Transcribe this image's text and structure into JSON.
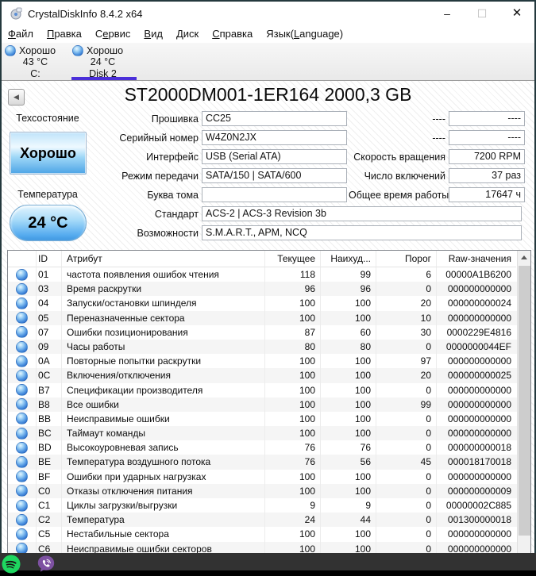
{
  "window": {
    "title": "CrystalDiskInfo 8.4.2 x64",
    "minimize_glyph": "–",
    "maximize_glyph": "☐",
    "close_glyph": "✕"
  },
  "menu": {
    "items": [
      {
        "id": "file",
        "pre": "",
        "key": "Ф",
        "post": "айл"
      },
      {
        "id": "edit",
        "pre": "",
        "key": "П",
        "post": "равка"
      },
      {
        "id": "function",
        "pre": "С",
        "key": "е",
        "post": "рвис"
      },
      {
        "id": "view",
        "pre": "",
        "key": "В",
        "post": "ид"
      },
      {
        "id": "disk",
        "pre": "",
        "key": "Д",
        "post": "иск"
      },
      {
        "id": "help",
        "pre": "",
        "key": "С",
        "post": "правка"
      },
      {
        "id": "language",
        "pre": "Язык(",
        "key": "L",
        "post": "anguage)"
      }
    ]
  },
  "drive_tabs": [
    {
      "status": "Хорошо",
      "temp": "43 °C",
      "name": "C:",
      "selected": false
    },
    {
      "status": "Хорошо",
      "temp": "24 °C",
      "name": "Disk 2",
      "selected": true
    }
  ],
  "header": {
    "back_glyph": "◀",
    "model": "ST2000DM001-1ER164 2000,3 GB"
  },
  "health": {
    "label": "Техсостояние",
    "value": "Хорошо"
  },
  "temperature": {
    "label": "Температура",
    "value": "24 °C"
  },
  "info_left": [
    {
      "label": "Прошивка",
      "value": "CC25"
    },
    {
      "label": "Серийный номер",
      "value": "W4Z0N2JX"
    },
    {
      "label": "Интерфейс",
      "value": "USB (Serial ATA)"
    },
    {
      "label": "Режим передачи",
      "value": "SATA/150 | SATA/600"
    },
    {
      "label": "Буква тома",
      "value": ""
    }
  ],
  "info_right": [
    {
      "label": "----",
      "value": "----"
    },
    {
      "label": "----",
      "value": "----"
    },
    {
      "label": "Скорость вращения",
      "value": "7200 RPM"
    },
    {
      "label": "Число включений",
      "value": "37 раз"
    },
    {
      "label": "Общее время работы",
      "value": "17647 ч"
    }
  ],
  "info_wide": [
    {
      "label": "Стандарт",
      "value": "ACS-2 | ACS-3 Revision 3b"
    },
    {
      "label": "Возможности",
      "value": "S.M.A.R.T., APM, NCQ"
    }
  ],
  "smart": {
    "columns": [
      "ID",
      "Атрибут",
      "Текущее",
      "Наихуд...",
      "Порог",
      "Raw-значения"
    ],
    "status_icon": "blue-health-sphere",
    "rows": [
      {
        "id": "01",
        "attr": "частота появления ошибок чтения",
        "cur": "118",
        "worst": "99",
        "thr": "6",
        "raw": "00000A1B6200"
      },
      {
        "id": "03",
        "attr": "Время раскрутки",
        "cur": "96",
        "worst": "96",
        "thr": "0",
        "raw": "000000000000"
      },
      {
        "id": "04",
        "attr": "Запуски/остановки шпинделя",
        "cur": "100",
        "worst": "100",
        "thr": "20",
        "raw": "000000000024"
      },
      {
        "id": "05",
        "attr": "Переназначенные сектора",
        "cur": "100",
        "worst": "100",
        "thr": "10",
        "raw": "000000000000"
      },
      {
        "id": "07",
        "attr": "Ошибки позиционирования",
        "cur": "87",
        "worst": "60",
        "thr": "30",
        "raw": "0000229E4816"
      },
      {
        "id": "09",
        "attr": "Часы работы",
        "cur": "80",
        "worst": "80",
        "thr": "0",
        "raw": "0000000044EF"
      },
      {
        "id": "0A",
        "attr": "Повторные попытки раскрутки",
        "cur": "100",
        "worst": "100",
        "thr": "97",
        "raw": "000000000000"
      },
      {
        "id": "0C",
        "attr": "Включения/отключения",
        "cur": "100",
        "worst": "100",
        "thr": "20",
        "raw": "000000000025"
      },
      {
        "id": "B7",
        "attr": "Спецификации производителя",
        "cur": "100",
        "worst": "100",
        "thr": "0",
        "raw": "000000000000"
      },
      {
        "id": "B8",
        "attr": "Все ошибки",
        "cur": "100",
        "worst": "100",
        "thr": "99",
        "raw": "000000000000"
      },
      {
        "id": "BB",
        "attr": "Неисправимые ошибки",
        "cur": "100",
        "worst": "100",
        "thr": "0",
        "raw": "000000000000"
      },
      {
        "id": "BC",
        "attr": "Таймаут команды",
        "cur": "100",
        "worst": "100",
        "thr": "0",
        "raw": "000000000000"
      },
      {
        "id": "BD",
        "attr": "Высокоуровневая запись",
        "cur": "76",
        "worst": "76",
        "thr": "0",
        "raw": "000000000018"
      },
      {
        "id": "BE",
        "attr": "Температура воздушного потока",
        "cur": "76",
        "worst": "56",
        "thr": "45",
        "raw": "000018170018"
      },
      {
        "id": "BF",
        "attr": "Ошибки при ударных нагрузках",
        "cur": "100",
        "worst": "100",
        "thr": "0",
        "raw": "000000000000"
      },
      {
        "id": "C0",
        "attr": "Отказы отключения питания",
        "cur": "100",
        "worst": "100",
        "thr": "0",
        "raw": "000000000009"
      },
      {
        "id": "C1",
        "attr": "Циклы загрузки/выгрузки",
        "cur": "9",
        "worst": "9",
        "thr": "0",
        "raw": "00000002C885"
      },
      {
        "id": "C2",
        "attr": "Температура",
        "cur": "24",
        "worst": "44",
        "thr": "0",
        "raw": "001300000018"
      },
      {
        "id": "C5",
        "attr": "Нестабильные сектора",
        "cur": "100",
        "worst": "100",
        "thr": "0",
        "raw": "000000000000"
      },
      {
        "id": "C6",
        "attr": "Неисправимые ошибки секторов",
        "cur": "100",
        "worst": "100",
        "thr": "0",
        "raw": "000000000000"
      }
    ]
  },
  "taskbar": {
    "icons": [
      "spotify-icon",
      "viber-icon"
    ]
  },
  "colors": {
    "tab_underline": "#4b2fd9",
    "health_blue": "#4da4e6",
    "taskbar_bg": "#323232",
    "spotify_green": "#1ed760",
    "viber_purple": "#7d51a1"
  }
}
